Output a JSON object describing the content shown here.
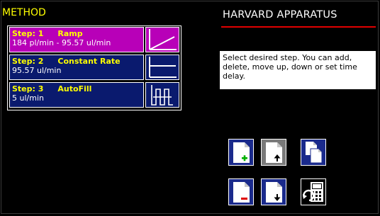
{
  "method": {
    "title": "METHOD"
  },
  "steps": [
    {
      "step_label": "Step: 1",
      "mode": "Ramp",
      "rate": "184 pl/min - 95.57 ul/min",
      "graph_icon": "ramp-graph-icon"
    },
    {
      "step_label": "Step: 2",
      "mode": "Constant Rate",
      "rate": "95.57 ul/min",
      "graph_icon": "constant-rate-graph-icon"
    },
    {
      "step_label": "Step: 3",
      "mode": "AutoFill",
      "rate": "5 ul/min",
      "graph_icon": "autofill-graph-icon"
    }
  ],
  "header": {
    "brand": "HARVARD APPARATUS"
  },
  "info": {
    "text": "Select desired step.  You can add, delete, move up, down or set time delay."
  },
  "buttons": {
    "add": {
      "icon": "add-step-icon"
    },
    "move_up": {
      "icon": "move-up-icon"
    },
    "copy": {
      "icon": "copy-step-icon"
    },
    "delete": {
      "icon": "delete-step-icon"
    },
    "move_down": {
      "icon": "move-down-icon"
    },
    "time_delay": {
      "icon": "time-delay-icon"
    }
  },
  "colors": {
    "title_yellow": "#ffff00",
    "ramp_magenta": "#b800b8",
    "step_navy": "#0a1a6e",
    "button_blue": "#1a2a8c",
    "button_gray": "#7a7a7a",
    "brand_underline": "#e00000",
    "add_green": "#00b000",
    "delete_red": "#e00000"
  }
}
